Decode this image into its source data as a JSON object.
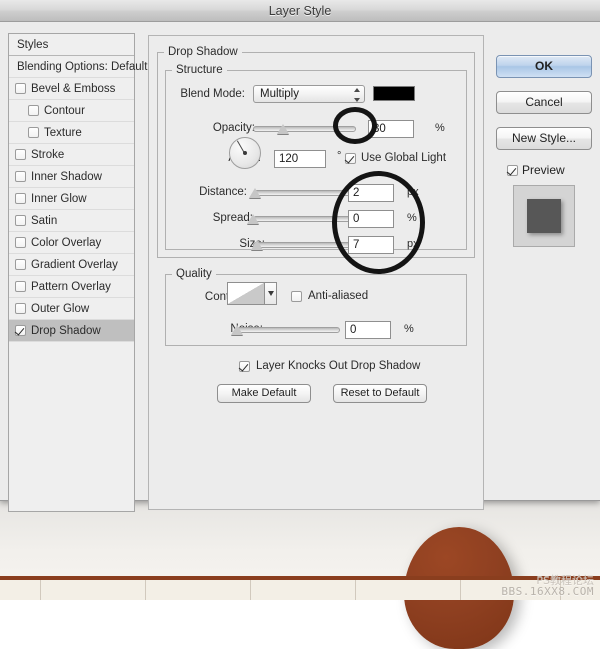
{
  "window": {
    "title": "Layer Style"
  },
  "styles_panel": {
    "header": "Styles",
    "blending_options": "Blending Options: Default",
    "items": [
      {
        "label": "Bevel & Emboss",
        "checked": false,
        "indent": false,
        "selected": false
      },
      {
        "label": "Contour",
        "checked": false,
        "indent": true,
        "selected": false
      },
      {
        "label": "Texture",
        "checked": false,
        "indent": true,
        "selected": false
      },
      {
        "label": "Stroke",
        "checked": false,
        "indent": false,
        "selected": false
      },
      {
        "label": "Inner Shadow",
        "checked": false,
        "indent": false,
        "selected": false
      },
      {
        "label": "Inner Glow",
        "checked": false,
        "indent": false,
        "selected": false
      },
      {
        "label": "Satin",
        "checked": false,
        "indent": false,
        "selected": false
      },
      {
        "label": "Color Overlay",
        "checked": false,
        "indent": false,
        "selected": false
      },
      {
        "label": "Gradient Overlay",
        "checked": false,
        "indent": false,
        "selected": false
      },
      {
        "label": "Pattern Overlay",
        "checked": false,
        "indent": false,
        "selected": false
      },
      {
        "label": "Outer Glow",
        "checked": false,
        "indent": false,
        "selected": false
      },
      {
        "label": "Drop Shadow",
        "checked": true,
        "indent": false,
        "selected": true
      }
    ]
  },
  "settings": {
    "group_title": "Drop Shadow",
    "structure": {
      "title": "Structure",
      "blend_mode": {
        "label": "Blend Mode:",
        "value": "Multiply",
        "color": "#000000"
      },
      "opacity": {
        "label": "Opacity:",
        "value": "30",
        "unit": "%",
        "slider_pct": 30
      },
      "angle": {
        "label": "Angle:",
        "value": "120",
        "unit": "°",
        "degrees": 120
      },
      "use_global_light": {
        "label": "Use Global Light",
        "checked": true
      },
      "distance": {
        "label": "Distance:",
        "value": "2",
        "unit": "px",
        "slider_pct": 2
      },
      "spread": {
        "label": "Spread:",
        "value": "0",
        "unit": "%",
        "slider_pct": 0
      },
      "size": {
        "label": "Size:",
        "value": "7",
        "unit": "px",
        "slider_pct": 5
      }
    },
    "quality": {
      "title": "Quality",
      "contour": {
        "label": "Contour:"
      },
      "anti_aliased": {
        "label": "Anti-aliased",
        "checked": false
      },
      "noise": {
        "label": "Noise:",
        "value": "0",
        "unit": "%",
        "slider_pct": 0
      }
    },
    "knocks_out": {
      "label": "Layer Knocks Out Drop Shadow",
      "checked": true
    },
    "make_default": "Make Default",
    "reset_to_default": "Reset to Default"
  },
  "buttons": {
    "ok": "OK",
    "cancel": "Cancel",
    "new_style": "New Style...",
    "preview": {
      "label": "Preview",
      "checked": true
    }
  },
  "watermark": {
    "line1": "PS教程论坛",
    "line2": "BBS.16XX8.COM"
  }
}
